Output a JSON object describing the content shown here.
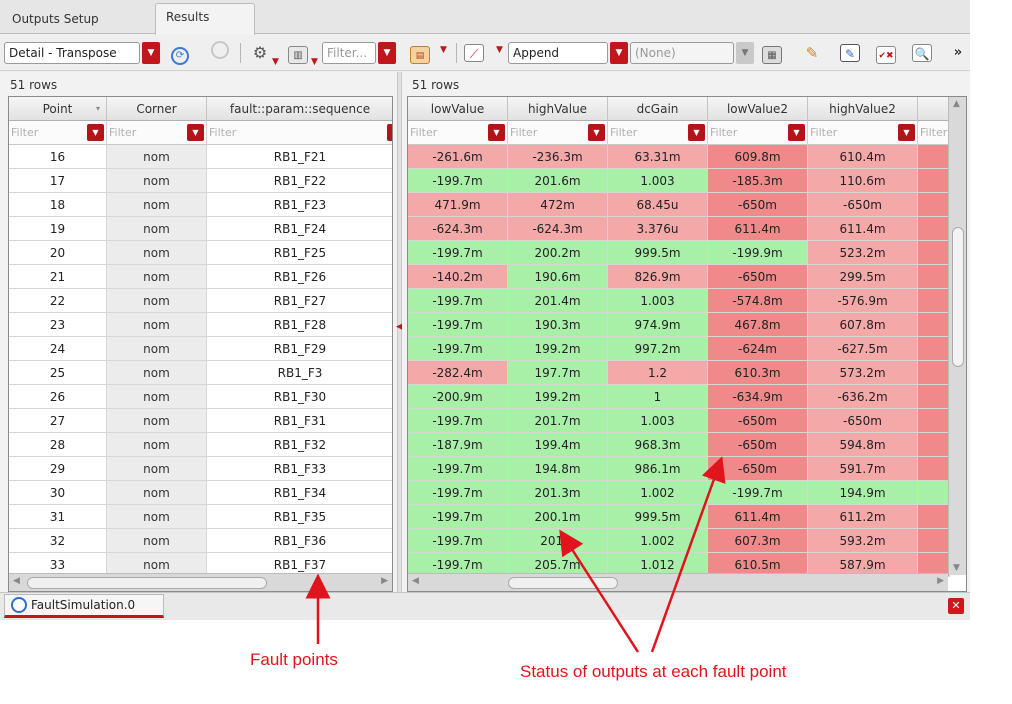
{
  "tabs": {
    "outputs_setup": "Outputs Setup",
    "results": "Results"
  },
  "toolbar": {
    "view_mode": "Detail - Transpose",
    "filter_placeholder": "Filter...",
    "append_mode": "Append",
    "history": "(None)",
    "overflow": "»"
  },
  "left": {
    "row_count": "51 rows",
    "columns": [
      "Point",
      "Corner",
      "fault::param::sequence"
    ],
    "filter_placeholder": "Filter",
    "rows": [
      [
        "16",
        "nom",
        "RB1_F21"
      ],
      [
        "17",
        "nom",
        "RB1_F22"
      ],
      [
        "18",
        "nom",
        "RB1_F23"
      ],
      [
        "19",
        "nom",
        "RB1_F24"
      ],
      [
        "20",
        "nom",
        "RB1_F25"
      ],
      [
        "21",
        "nom",
        "RB1_F26"
      ],
      [
        "22",
        "nom",
        "RB1_F27"
      ],
      [
        "23",
        "nom",
        "RB1_F28"
      ],
      [
        "24",
        "nom",
        "RB1_F29"
      ],
      [
        "25",
        "nom",
        "RB1_F3"
      ],
      [
        "26",
        "nom",
        "RB1_F30"
      ],
      [
        "27",
        "nom",
        "RB1_F31"
      ],
      [
        "28",
        "nom",
        "RB1_F32"
      ],
      [
        "29",
        "nom",
        "RB1_F33"
      ],
      [
        "30",
        "nom",
        "RB1_F34"
      ],
      [
        "31",
        "nom",
        "RB1_F35"
      ],
      [
        "32",
        "nom",
        "RB1_F36"
      ]
    ],
    "partial_row": [
      "33",
      "nom",
      "RB1_F37"
    ]
  },
  "right": {
    "row_count": "51 rows",
    "columns": [
      "lowValue",
      "highValue",
      "dcGain",
      "lowValue2",
      "highValue2",
      ""
    ],
    "filter_placeholder": "Filter",
    "colors": {
      "pass": "#a8f0a8",
      "fail": "#f5a8a8",
      "fail_strong": "#f08a8a"
    },
    "rows": [
      [
        [
          "-261.6m",
          "fail"
        ],
        [
          "-236.3m",
          "fail"
        ],
        [
          "63.31m",
          "fail"
        ],
        [
          "609.8m",
          "fail"
        ],
        [
          "610.4m",
          "fail"
        ],
        [
          "",
          "fail"
        ]
      ],
      [
        [
          "-199.7m",
          "pass"
        ],
        [
          "201.6m",
          "pass"
        ],
        [
          "1.003",
          "pass"
        ],
        [
          "-185.3m",
          "fail"
        ],
        [
          "110.6m",
          "fail"
        ],
        [
          "",
          "fail"
        ]
      ],
      [
        [
          "471.9m",
          "fail"
        ],
        [
          "472m",
          "fail"
        ],
        [
          "68.45u",
          "fail"
        ],
        [
          "-650m",
          "fail"
        ],
        [
          "-650m",
          "fail"
        ],
        [
          "",
          "fail"
        ]
      ],
      [
        [
          "-624.3m",
          "fail"
        ],
        [
          "-624.3m",
          "fail"
        ],
        [
          "3.376u",
          "fail"
        ],
        [
          "611.4m",
          "fail"
        ],
        [
          "611.4m",
          "fail"
        ],
        [
          "",
          "fail"
        ]
      ],
      [
        [
          "-199.7m",
          "pass"
        ],
        [
          "200.2m",
          "pass"
        ],
        [
          "999.5m",
          "pass"
        ],
        [
          "-199.9m",
          "pass"
        ],
        [
          "523.2m",
          "fail"
        ],
        [
          "",
          "fail"
        ]
      ],
      [
        [
          "-140.2m",
          "fail"
        ],
        [
          "190.6m",
          "pass"
        ],
        [
          "826.9m",
          "fail"
        ],
        [
          "-650m",
          "fail"
        ],
        [
          "299.5m",
          "fail"
        ],
        [
          "",
          "fail"
        ]
      ],
      [
        [
          "-199.7m",
          "pass"
        ],
        [
          "201.4m",
          "pass"
        ],
        [
          "1.003",
          "pass"
        ],
        [
          "-574.8m",
          "fail"
        ],
        [
          "-576.9m",
          "fail"
        ],
        [
          "",
          "fail"
        ]
      ],
      [
        [
          "-199.7m",
          "pass"
        ],
        [
          "190.3m",
          "pass"
        ],
        [
          "974.9m",
          "pass"
        ],
        [
          "467.8m",
          "fail"
        ],
        [
          "607.8m",
          "fail"
        ],
        [
          "",
          "fail"
        ]
      ],
      [
        [
          "-199.7m",
          "pass"
        ],
        [
          "199.2m",
          "pass"
        ],
        [
          "997.2m",
          "pass"
        ],
        [
          "-624m",
          "fail"
        ],
        [
          "-627.5m",
          "fail"
        ],
        [
          "",
          "fail"
        ]
      ],
      [
        [
          "-282.4m",
          "fail"
        ],
        [
          "197.7m",
          "pass"
        ],
        [
          "1.2",
          "fail"
        ],
        [
          "610.3m",
          "fail"
        ],
        [
          "573.2m",
          "fail"
        ],
        [
          "",
          "fail"
        ]
      ],
      [
        [
          "-200.9m",
          "pass"
        ],
        [
          "199.2m",
          "pass"
        ],
        [
          "1",
          "pass"
        ],
        [
          "-634.9m",
          "fail"
        ],
        [
          "-636.2m",
          "fail"
        ],
        [
          "",
          "fail"
        ]
      ],
      [
        [
          "-199.7m",
          "pass"
        ],
        [
          "201.7m",
          "pass"
        ],
        [
          "1.003",
          "pass"
        ],
        [
          "-650m",
          "fail"
        ],
        [
          "-650m",
          "fail"
        ],
        [
          "",
          "fail"
        ]
      ],
      [
        [
          "-187.9m",
          "pass"
        ],
        [
          "199.4m",
          "pass"
        ],
        [
          "968.3m",
          "pass"
        ],
        [
          "-650m",
          "fail"
        ],
        [
          "594.8m",
          "fail"
        ],
        [
          "",
          "fail"
        ]
      ],
      [
        [
          "-199.7m",
          "pass"
        ],
        [
          "194.8m",
          "pass"
        ],
        [
          "986.1m",
          "pass"
        ],
        [
          "-650m",
          "fail"
        ],
        [
          "591.7m",
          "fail"
        ],
        [
          "",
          "fail"
        ]
      ],
      [
        [
          "-199.7m",
          "pass"
        ],
        [
          "201.3m",
          "pass"
        ],
        [
          "1.002",
          "pass"
        ],
        [
          "-199.7m",
          "pass"
        ],
        [
          "194.9m",
          "pass"
        ],
        [
          "",
          "pass"
        ]
      ],
      [
        [
          "-199.7m",
          "pass"
        ],
        [
          "200.1m",
          "pass"
        ],
        [
          "999.5m",
          "pass"
        ],
        [
          "611.4m",
          "fail"
        ],
        [
          "611.2m",
          "fail"
        ],
        [
          "",
          "fail"
        ]
      ],
      [
        [
          "-199.7m",
          "pass"
        ],
        [
          "201m",
          "pass"
        ],
        [
          "1.002",
          "pass"
        ],
        [
          "607.3m",
          "fail"
        ],
        [
          "593.2m",
          "fail"
        ],
        [
          "",
          "fail"
        ]
      ]
    ],
    "partial_row": [
      [
        "-199.7m",
        "pass"
      ],
      [
        "205.7m",
        "pass"
      ],
      [
        "1.012",
        "pass"
      ],
      [
        "610.5m",
        "fail"
      ],
      [
        "587.9m",
        "fail"
      ],
      [
        "",
        "fail"
      ]
    ]
  },
  "bottom": {
    "tab_label": "FaultSimulation.0"
  },
  "annotations": {
    "fault_points": "Fault points",
    "status_outputs": "Status of outputs at each fault point"
  }
}
